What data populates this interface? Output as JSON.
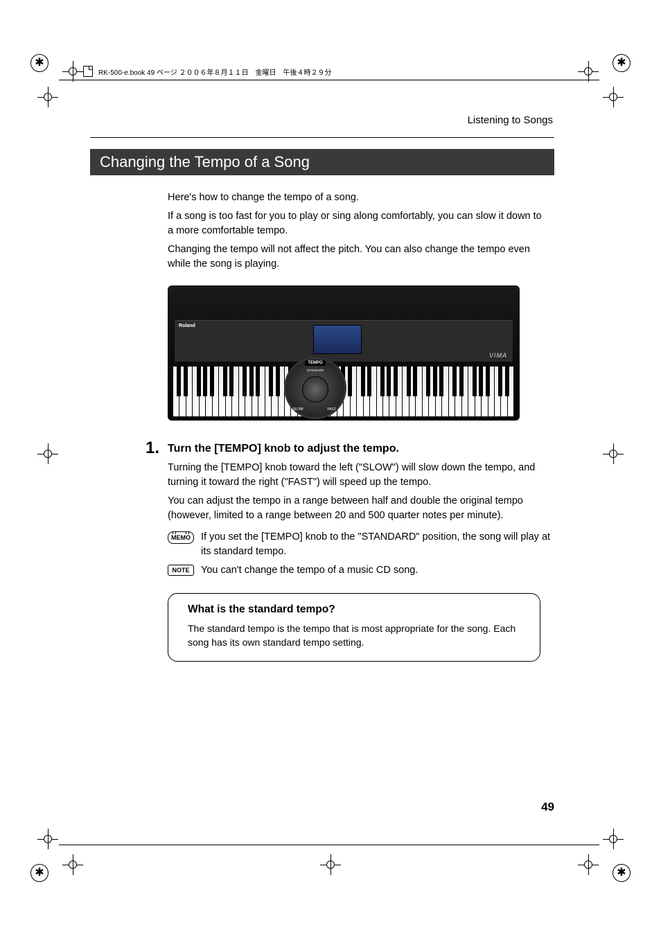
{
  "meta": {
    "doc_meta": "RK-500-e.book  49 ページ  ２００６年８月１１日　金曜日　午後４時２９分"
  },
  "header": {
    "breadcrumb": "Listening to Songs"
  },
  "section": {
    "title": "Changing the Tempo of a Song",
    "intro": [
      "Here's how to change the tempo of a song.",
      "If a song is too fast for you to play or sing along comfortably, you can slow it down to a more comfortable tempo.",
      "Changing the tempo will not affect the pitch. You can also change the tempo even while the song is playing."
    ]
  },
  "keyboard": {
    "brand": "Roland",
    "logo": "VIMA",
    "knob_label": "TEMPO",
    "knob_standard": "STANDARD",
    "knob_slow": "SLOW",
    "knob_fast": "FAST"
  },
  "step": {
    "number": "1.",
    "title": "Turn the [TEMPO] knob to adjust the tempo.",
    "body": [
      "Turning the [TEMPO] knob toward the left (\"SLOW\") will slow down the tempo, and turning it toward the right (\"FAST\") will speed up the tempo.",
      "You can adjust the tempo in a range between half and double the original tempo (however, limited to a range between 20 and 500 quarter notes per minute)."
    ],
    "memo_label": "MEMO",
    "memo_text": "If you set the [TEMPO] knob to the \"STANDARD\" position, the song will play at its standard tempo.",
    "note_label": "NOTE",
    "note_text": "You can't change the tempo of a music CD song."
  },
  "infobox": {
    "question": "What is the standard tempo?",
    "answer": "The standard tempo is the tempo that is most appropriate for the song. Each song has its own standard tempo setting."
  },
  "page_number": "49"
}
